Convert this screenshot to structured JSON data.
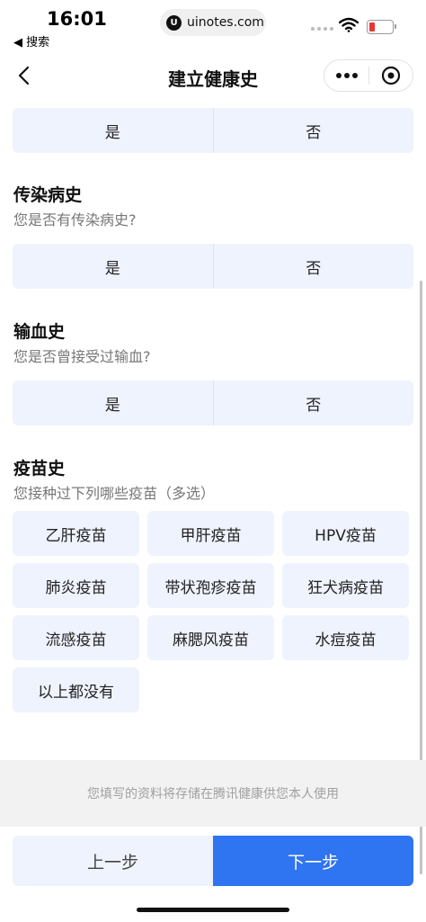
{
  "status_bar": {
    "time": "16:01",
    "back_app": "◀ 搜索",
    "url": "uinotes.com",
    "url_logo": "U"
  },
  "nav": {
    "title": "建立健康史",
    "back_icon": "chevron-left-icon",
    "more_icon": "more-dots-icon",
    "close_icon": "target-circle-icon"
  },
  "common": {
    "yes": "是",
    "no": "否"
  },
  "sections": {
    "infectious": {
      "title": "传染病史",
      "question": "您是否有传染病史?"
    },
    "transfusion": {
      "title": "输血史",
      "question": "您是否曾接受过输血?"
    },
    "vaccine": {
      "title": "疫苗史",
      "question": "您接种过下列哪些疫苗（多选）",
      "options": [
        "乙肝疫苗",
        "甲肝疫苗",
        "HPV疫苗",
        "肺炎疫苗",
        "带状孢疹疫苗",
        "狂犬病疫苗",
        "流感疫苗",
        "麻腮风疫苗",
        "水痘疫苗",
        "以上都没有"
      ]
    }
  },
  "footer": {
    "notice": "您填写的资料将存储在腾讯健康供您本人使用",
    "prev": "上一步",
    "next": "下一步"
  },
  "colors": {
    "accent": "#2f74f0",
    "option_bg": "#eef3fd",
    "notice_bg": "#f2f2f2"
  }
}
